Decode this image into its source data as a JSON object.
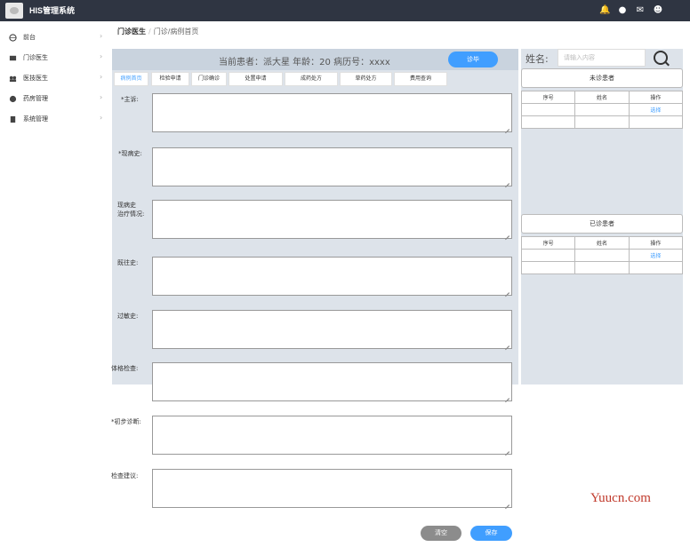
{
  "app": {
    "title": "HIS管理系统"
  },
  "sidebar": {
    "items": [
      {
        "label": "前台",
        "icon": "globe-icon"
      },
      {
        "label": "门诊医生",
        "icon": "monitor-icon"
      },
      {
        "label": "医技医生",
        "icon": "users-icon"
      },
      {
        "label": "药房管理",
        "icon": "pill-icon"
      },
      {
        "label": "系统管理",
        "icon": "document-icon"
      }
    ]
  },
  "breadcrumb": {
    "root": "门诊医生",
    "separator": "/",
    "current": "门诊/病例首页"
  },
  "patient_bar": {
    "info": "当前患者：派大星 年龄：20 病历号：xxxx",
    "diagnose_button": "诊毕"
  },
  "tabs": [
    "病例首页",
    "检验申请",
    "门诊确诊",
    "处置申请",
    "成药处方",
    "草药处方",
    "费用查询"
  ],
  "form": {
    "fields": [
      {
        "label": "*主诉:"
      },
      {
        "label": "*现病史:"
      },
      {
        "label": "现病史\n治疗情况:"
      },
      {
        "label": "既往史:"
      },
      {
        "label": "过敏史:"
      },
      {
        "label": "体格检查:"
      },
      {
        "label": "*初步诊断:"
      },
      {
        "label": "检查建议:"
      }
    ],
    "clear_button": "清空",
    "save_button": "保存"
  },
  "search": {
    "label": "姓名:",
    "placeholder": "请输入内容"
  },
  "undiagnosed": {
    "title": "未诊患者",
    "columns": [
      "序号",
      "姓名",
      "操作"
    ],
    "rows": [
      [
        "",
        "",
        "选择"
      ],
      [
        "",
        "",
        ""
      ]
    ]
  },
  "diagnosed": {
    "title": "已诊患者",
    "columns": [
      "序号",
      "姓名",
      "操作"
    ],
    "rows": [
      [
        "",
        "",
        "选择"
      ],
      [
        "",
        "",
        ""
      ]
    ]
  },
  "watermark": "Yuucn.com",
  "colors": {
    "topbar": "#2f3542",
    "accent": "#409eff",
    "panel_bg": "#dde3ea",
    "clear_button": "#8c8c8c"
  }
}
